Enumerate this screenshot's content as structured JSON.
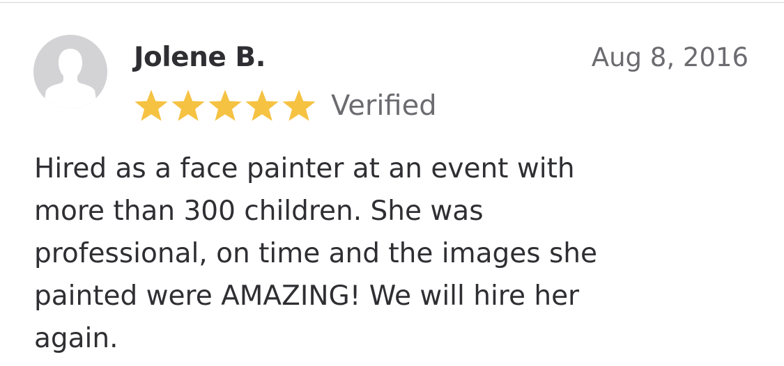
{
  "review": {
    "reviewer_name": "Jolene B.",
    "date": "Aug 8, 2016",
    "rating": 5,
    "rating_max": 5,
    "verified_label": "Verified",
    "text_lines": [
      "Hired as a face painter at an event with",
      "more than 300 children. She was",
      "professional, on time and the images she",
      "painted were AMAZING! We will hire her",
      "again."
    ]
  },
  "icons": {
    "avatar": "person-silhouette-icon",
    "star": "star-filled-icon"
  },
  "colors": {
    "star": "#F5C242",
    "avatar_bg": "#D3D3D5",
    "avatar_figure": "#FFFFFF",
    "text_primary": "#2F2F33",
    "text_secondary": "#6B6B70",
    "divider": "#D6D6D6"
  }
}
